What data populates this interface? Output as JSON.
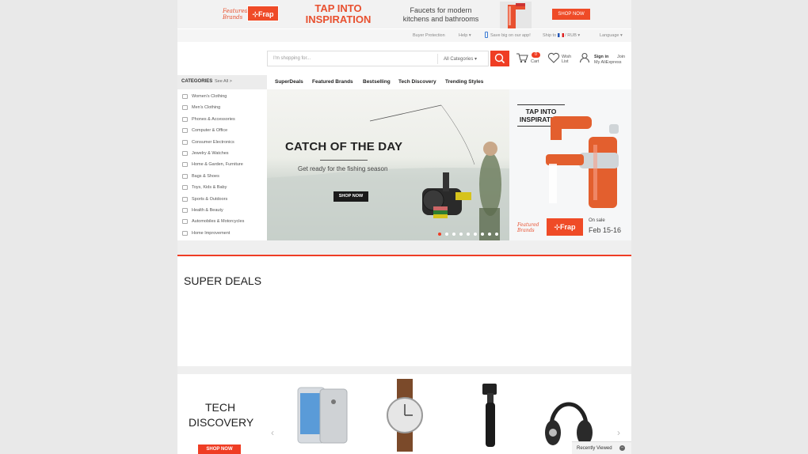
{
  "top_banner": {
    "brands_line1": "Featured",
    "brands_line2": "Brands",
    "frap_logo": "Frap",
    "tap_line1": "TAP INTO",
    "tap_line2": "INSPIRATION",
    "faucets_line1": "Faucets for modern",
    "faucets_line2": "kitchens and bathrooms",
    "shop_now": "SHOP NOW"
  },
  "util_nav": {
    "buyer_protection": "Buyer Protection",
    "help": "Help",
    "save_app": "Save big on our app!",
    "ship_to": "Ship to",
    "currency": "RUB",
    "language": "Language"
  },
  "search": {
    "placeholder": "I'm shopping for...",
    "category": "All Categories"
  },
  "header": {
    "cart_label": "Cart",
    "cart_count": "0",
    "wish_line1": "Wish",
    "wish_line2": "List",
    "sign_in": "Sign in",
    "join": "Join",
    "my_aliexpress": "My AliExpress"
  },
  "categories": {
    "title": "CATEGORIES",
    "see_all": "See All >",
    "items": [
      "Women's Clothing",
      "Men's Clothing",
      "Phones & Accessories",
      "Computer & Office",
      "Consumer Electronics",
      "Jewelry & Watches",
      "Home & Garden, Furniture",
      "Bags & Shoes",
      "Toys, Kids & Baby",
      "Sports & Outdoors",
      "Health & Beauty",
      "Automobiles & Motorcycles",
      "Home Improvement"
    ]
  },
  "nav_tabs": [
    "SuperDeals",
    "Featured Brands",
    "Bestselling",
    "Tech Discovery",
    "Trending Styles"
  ],
  "hero": {
    "title": "CATCH OF THE DAY",
    "subtitle": "Get ready for the fishing season",
    "button": "SHOP NOW",
    "dot_count": 9,
    "active_dot": 0
  },
  "side_promo": {
    "title_line1": "TAP INTO",
    "title_line2": "INSPIRATION",
    "brands_line1": "Featured",
    "brands_line2": "Brands",
    "frap_logo": "Frap",
    "on_sale": "On sale",
    "date": "Feb 15-16"
  },
  "super_deals": {
    "title": "SUPER DEALS"
  },
  "tech_discovery": {
    "title_line1": "TECH",
    "title_line2": "DISCOVERY",
    "button": "SHOP NOW"
  },
  "recently_viewed": {
    "label": "Recently Viewed"
  },
  "colors": {
    "accent": "#ef3d24",
    "brand_orange": "#ef4b27"
  }
}
